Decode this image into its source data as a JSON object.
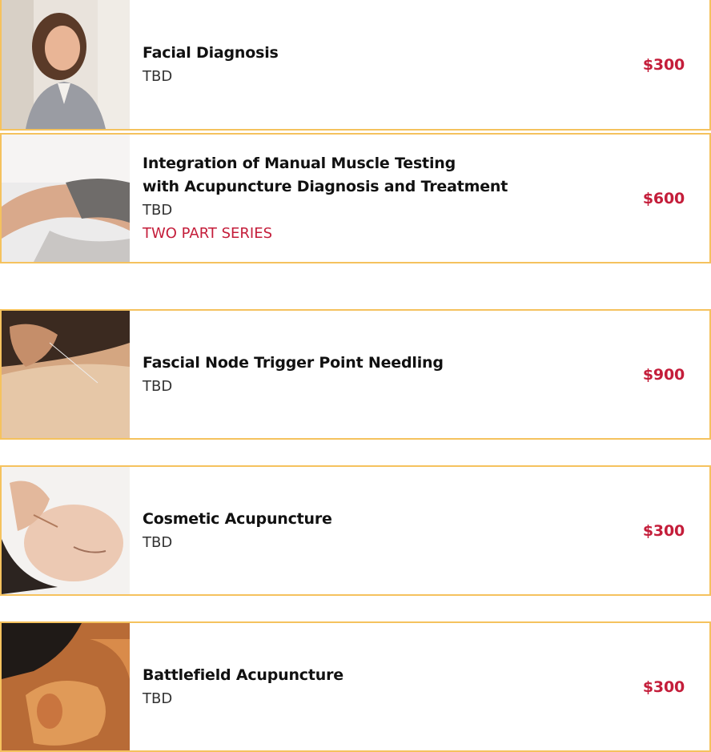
{
  "courses": [
    {
      "title": "Facial Diagnosis",
      "status": "TBD",
      "note": "",
      "price": "$300",
      "image": "woman-portrait-photo"
    },
    {
      "title": "Integration of Manual Muscle Testing\nwith Acupuncture Diagnosis and Treatment",
      "status": "TBD",
      "note": "TWO PART SERIES",
      "price": "$600",
      "image": "muscle-testing-photo"
    },
    {
      "title": "Fascial Node Trigger Point Needling",
      "status": "TBD",
      "note": "",
      "price": "$900",
      "image": "needling-photo"
    },
    {
      "title": "Cosmetic Acupuncture",
      "status": "TBD",
      "note": "",
      "price": "$300",
      "image": "facial-acupuncture-photo"
    },
    {
      "title": "Battlefield Acupuncture",
      "status": "TBD",
      "note": "",
      "price": "$300",
      "image": "ear-acupuncture-photo"
    }
  ],
  "colors": {
    "border": "#f5c25e",
    "price": "#c41d3a",
    "note": "#c41d3a"
  }
}
